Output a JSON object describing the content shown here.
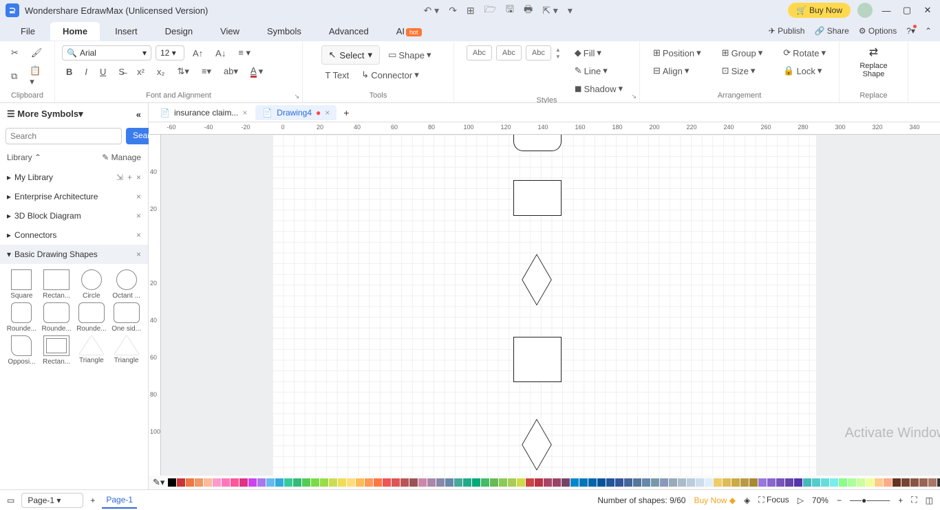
{
  "titlebar": {
    "app_title": "Wondershare EdrawMax (Unlicensed Version)",
    "buy_now": "Buy Now"
  },
  "menu": {
    "tabs": [
      "File",
      "Home",
      "Insert",
      "Design",
      "View",
      "Symbols",
      "Advanced",
      "AI"
    ],
    "active": 1,
    "hot": "hot",
    "right": {
      "publish": "Publish",
      "share": "Share",
      "options": "Options"
    }
  },
  "ribbon": {
    "clipboard": "Clipboard",
    "font_align": "Font and Alignment",
    "font_name": "Arial",
    "font_size": "12",
    "tools": "Tools",
    "select": "Select",
    "shape": "Shape",
    "text": "Text",
    "connector": "Connector",
    "styles": "Styles",
    "abc": "Abc",
    "fill": "Fill",
    "line": "Line",
    "shadow": "Shadow",
    "arrangement": "Arrangement",
    "position": "Position",
    "align": "Align",
    "group": "Group",
    "size": "Size",
    "rotate": "Rotate",
    "lock": "Lock",
    "replace": "Replace",
    "replace_shape": "Replace\nShape"
  },
  "sidebar": {
    "more_symbols": "More Symbols",
    "search_placeholder": "Search",
    "search_btn": "Search",
    "library": "Library",
    "manage": "Manage",
    "items": [
      {
        "label": "My Library"
      },
      {
        "label": "Enterprise Architecture"
      },
      {
        "label": "3D Block Diagram"
      },
      {
        "label": "Connectors"
      },
      {
        "label": "Basic Drawing Shapes"
      }
    ],
    "shapes": [
      {
        "label": "Square",
        "kind": "square"
      },
      {
        "label": "Rectan...",
        "kind": "rect"
      },
      {
        "label": "Circle",
        "kind": "circle"
      },
      {
        "label": "Octant ...",
        "kind": "circle"
      },
      {
        "label": "Rounde...",
        "kind": "roundsq"
      },
      {
        "label": "Rounde...",
        "kind": "roundrect"
      },
      {
        "label": "Rounde...",
        "kind": "roundrect"
      },
      {
        "label": "One sid...",
        "kind": "roundrect"
      },
      {
        "label": "Opposi...",
        "kind": "opp"
      },
      {
        "label": "Rectan...",
        "kind": "inset"
      },
      {
        "label": "Triangle",
        "kind": "tri"
      },
      {
        "label": "Triangle",
        "kind": "tri2"
      }
    ]
  },
  "tabs": [
    {
      "label": "insurance claim...",
      "active": false
    },
    {
      "label": "Drawing4",
      "active": true
    }
  ],
  "ruler_h": [
    "-60",
    "-40",
    "-20",
    "0",
    "20",
    "40",
    "60",
    "80",
    "100",
    "120",
    "140",
    "160",
    "180",
    "200",
    "220",
    "240",
    "260",
    "280",
    "300",
    "320",
    "340"
  ],
  "ruler_v": [
    "",
    "40",
    "20",
    "",
    "20",
    "40",
    "60",
    "80",
    "100"
  ],
  "bottombar": {
    "page_dd": "Page-1",
    "page_tab": "Page-1",
    "shapes_count": "Number of shapes: 9/60",
    "buy_now": "Buy Now",
    "focus": "Focus",
    "zoom": "70%"
  },
  "watermark": "Activate Windows",
  "colors": [
    "#000",
    "#c33",
    "#e74",
    "#e96",
    "#fb9",
    "#f9c",
    "#f7b",
    "#f59",
    "#d38",
    "#c4e",
    "#a7e",
    "#6be",
    "#3ad",
    "#3c9",
    "#3b7",
    "#5c5",
    "#7d4",
    "#9d4",
    "#cd5",
    "#ed5",
    "#fd7",
    "#fb5",
    "#f95",
    "#f74",
    "#e55",
    "#d55",
    "#b55",
    "#955",
    "#c8a",
    "#a8a",
    "#88a",
    "#68a",
    "#4a9",
    "#2a8",
    "#0a7",
    "#4b6",
    "#6b5",
    "#8c5",
    "#ac5",
    "#cd4",
    "#c44",
    "#b34",
    "#a46",
    "#946",
    "#746",
    "#08c",
    "#07b",
    "#06a",
    "#059",
    "#259",
    "#359",
    "#469",
    "#579",
    "#68a",
    "#79a",
    "#89b",
    "#9ab",
    "#abc",
    "#bcd",
    "#cde",
    "#def",
    "#ec6",
    "#db5",
    "#ca4",
    "#b94",
    "#a83",
    "#97d",
    "#86c",
    "#75b",
    "#64a",
    "#53a",
    "#4bb",
    "#5cc",
    "#6dd",
    "#7ee",
    "#8f8",
    "#af9",
    "#cf9",
    "#ef9",
    "#fc8",
    "#fa8",
    "#632",
    "#743",
    "#854",
    "#965",
    "#a76",
    "#333",
    "#555",
    "#777",
    "#999",
    "#bbb",
    "#ddd"
  ]
}
